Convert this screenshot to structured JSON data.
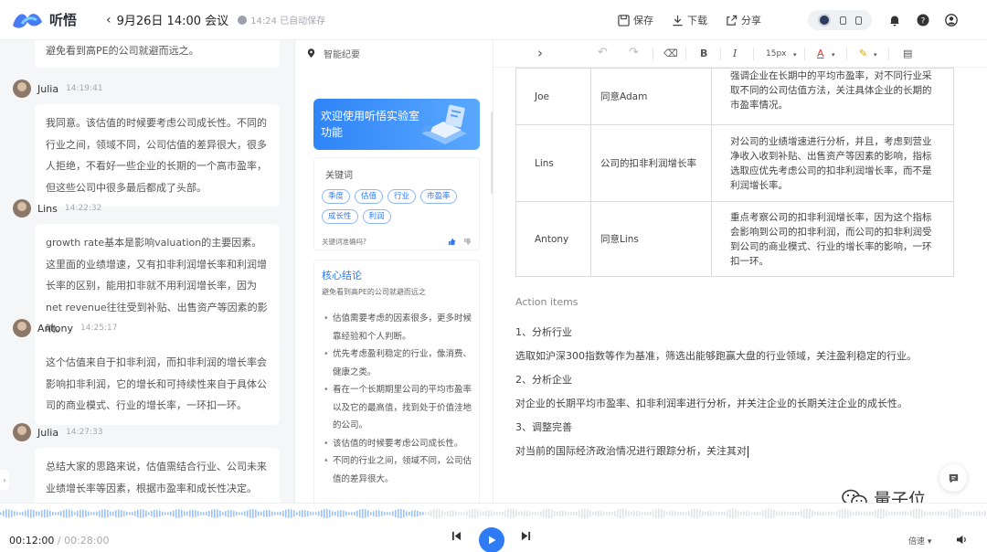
{
  "header": {
    "app_name": "听悟",
    "title": "9月26日 14:00 会议",
    "autosave": "14:24 已自动保存",
    "actions": [
      {
        "label": "保存",
        "icon": "save-icon"
      },
      {
        "label": "下载",
        "icon": "download-icon"
      },
      {
        "label": "分享",
        "icon": "share-icon"
      }
    ]
  },
  "transcript": [
    {
      "speaker": "",
      "time": "",
      "text": "避免看到高PE的公司就避而远之。"
    },
    {
      "speaker": "Julia",
      "time": "14:19:41",
      "text": "我同意。该估值的时候要考虑公司成长性。不同的行业之间，领域不同，公司估值的差异很大，很多人拒绝，不看好一些企业的长期的一个高市盈率，但这些公司中很多最后都成了头部。"
    },
    {
      "speaker": "Lins",
      "time": "14:22:32",
      "text": "growth rate基本是影响valuation的主要因素。这里面的业绩增速，又有扣非利润增长率和利润增长率的区别，能用扣非就不用利润增长率，因为net revenue往往受到补贴、出售资产等因素的影响。"
    },
    {
      "speaker": "Antony",
      "time": "14:25:17",
      "text": "这个估值来自于扣非利润，而扣非利润的增长率会影响扣非利润，它的增长和可持续性来自于具体公司的商业模式、行业的增长率，一环扣一环。"
    },
    {
      "speaker": "Julia",
      "time": "14:27:33",
      "text": "总结大家的思路来说，估值需结合行业、公司未来业绩增长率等因素，根据市盈率和成长性决定。"
    }
  ],
  "summary": {
    "header": "智能纪要",
    "banner": "欢迎使用听悟实验室功能",
    "keywords_title": "关键词",
    "keywords": [
      "季度",
      "估值",
      "行业",
      "市盈率",
      "成长性",
      "利润"
    ],
    "keywords_feedback": "关键词准确吗?",
    "core_title": "核心结论",
    "core_subtitle": "避免看到高PE的公司就避而远之",
    "core_points": [
      "估值需要考虑的因素很多，更多时候靠经验和个人判断。",
      "优先考虑盈利稳定的行业，像消费、健康之类。",
      "看在一个长期期里公司的平均市盈率以及它的最高值，找到处于价值洼地的公司。",
      "该估值的时候要考虑公司成长性。",
      "不同的行业之间，领域不同，公司估值的差异很大。"
    ]
  },
  "toolbar": {
    "expand": "›",
    "undo": "↶",
    "redo": "↷",
    "eraser": "⌫",
    "bold": "B",
    "italic": "I",
    "font_size": "15px",
    "font_color": "A",
    "highlight": "✎",
    "doc": "▤"
  },
  "table": {
    "rows": [
      {
        "name": "Joe",
        "view": "同意Adam",
        "note": "强调企业在长期中的平均市盈率，对不同行业采取不同的公司估值方法，关注具体企业的长期的市盈率情况。"
      },
      {
        "name": "Lins",
        "view": "公司的扣非利润增长率",
        "note": "对公司的业绩增速进行分析，并且，考虑到营业净收入收到补贴、出售资产等因素的影响，指标选取应优先考虑公司的扣非利润增长率，而不是利润增长率。"
      },
      {
        "name": "Antony",
        "view": "同意Lins",
        "note": "重点考察公司的扣非利润增长率，因为这个指标会影响到公司的扣非利润，而公司的扣非利润受到公司的商业模式、行业的增长率的影响，一环扣一环。"
      }
    ]
  },
  "action_items": {
    "title": "Action items",
    "lines": [
      "1、分析行业",
      "选取如沪深300指数等作为基准，筛选出能够跑赢大盘的行业领域，关注盈利稳定的行业。",
      "2、分析企业",
      "对企业的长期平均市盈率、扣非利润率进行分析，并关注企业的长期关注企业的成长性。",
      "3、调整完善",
      "对当前的国际经济政治情况进行跟踪分析，关注其对"
    ]
  },
  "watermark": "量子位",
  "player": {
    "current": "00:12:00",
    "separator": " / ",
    "total": "00:28:00",
    "speed": "倍速",
    "speed_arrow": "▾",
    "progress": 0.43
  },
  "colors": {
    "accent": "#2f7bf5",
    "wave_played": "#9cc3fb",
    "wave_rest": "#dfe3ea"
  }
}
